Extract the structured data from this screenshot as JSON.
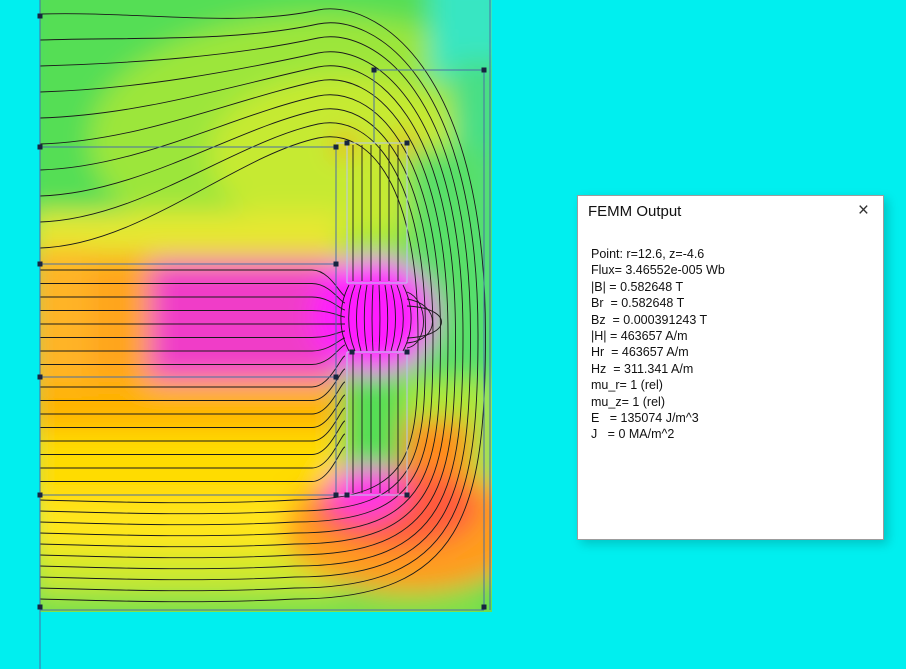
{
  "dialog": {
    "title": "FEMM Output",
    "close_glyph": "×",
    "lines": [
      "Point: r=12.6, z=-4.6",
      "Flux= 3.46552e-005 Wb",
      "|B| = 0.582648 T",
      "Br  = 0.582648 T",
      "Bz  = 0.000391243 T",
      "|H| = 463657 A/m",
      "Hr  = 463657 A/m",
      "Hz  = 311.341 A/m",
      "mu_r= 1 (rel)",
      "mu_z= 1 (rel)",
      "E   = 135074 J/m^3",
      "J   = 0 MA/m^2"
    ]
  },
  "colors": {
    "canvas_background": "#00EFEF",
    "dialog_background": "#FFFFFF",
    "contour_line": "#1B1B1B",
    "geometry_line": "#4A6FA5",
    "colormap_high": "#FF00FF",
    "colormap_mid": "#FFA500",
    "colormap_low": "#00FFFF"
  }
}
